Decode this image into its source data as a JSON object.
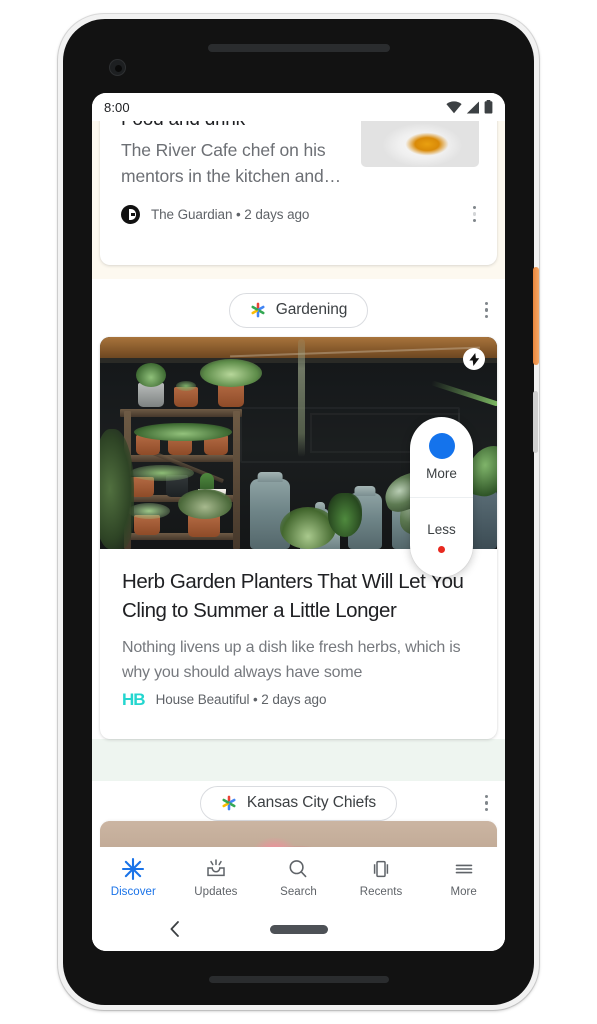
{
  "status_bar": {
    "time": "8:00",
    "icons": [
      "wifi-icon",
      "cellular-signal-icon",
      "battery-icon"
    ]
  },
  "feed": {
    "cards": [
      {
        "id": "guardian-card",
        "partial": true,
        "headline_clipped": "Food and drink",
        "title": "The River Cafe chef on his mentors in the kitchen and…",
        "publisher": "The Guardian",
        "time_ago": "2 days ago",
        "footer_text": "The Guardian • 2 days ago",
        "logo": "guardian-logo",
        "thumbnail": "food-plate-photo",
        "overflow_icon": "more-vert-icon"
      },
      {
        "id": "garden-card",
        "topic_chip": {
          "label": "Gardening",
          "icon": "google-discover-asterisk-icon"
        },
        "topic_overflow_icon": "more-vert-icon",
        "image": "potted-plants-on-wooden-shelf-photo",
        "amp_badge": "amp-lightning-icon",
        "headline": "Herb Garden Planters That Will Let You Cling to Summer a Little Longer",
        "snippet": "Nothing livens up a dish like fresh herbs, which is why you should always have some",
        "publisher": "House Beautiful",
        "time_ago": "2 days ago",
        "footer_text": "House Beautiful • 2 days ago",
        "logo_text": "HB",
        "logo_color": "#23d6cf"
      },
      {
        "id": "chiefs-card",
        "topic_chip": {
          "label": "Kansas City Chiefs",
          "icon": "google-discover-asterisk-icon"
        },
        "topic_overflow_icon": "more-vert-icon",
        "image": "pink-flamingo-photo-peek",
        "amp_badge": "amp-lightning-icon"
      }
    ]
  },
  "feedback_overlay": {
    "more_label": "More",
    "less_label": "Less",
    "more_dot_color": "#1473ec",
    "less_dot_color": "#e8291f"
  },
  "bottom_nav": {
    "items": [
      {
        "label": "Discover",
        "icon": "discover-asterisk-icon",
        "active": true
      },
      {
        "label": "Updates",
        "icon": "updates-inbox-icon",
        "active": false
      },
      {
        "label": "Search",
        "icon": "search-magnifier-icon",
        "active": false
      },
      {
        "label": "Recents",
        "icon": "recents-cards-icon",
        "active": false
      },
      {
        "label": "More",
        "icon": "more-hamburger-icon",
        "active": false
      }
    ],
    "active_color": "#1a73e8",
    "inactive_color": "#5f6368"
  },
  "system_nav": {
    "back_icon": "back-chevron-icon",
    "home_pill": "gesture-home-pill"
  },
  "device": {
    "power_button_color": "#e8853c"
  }
}
